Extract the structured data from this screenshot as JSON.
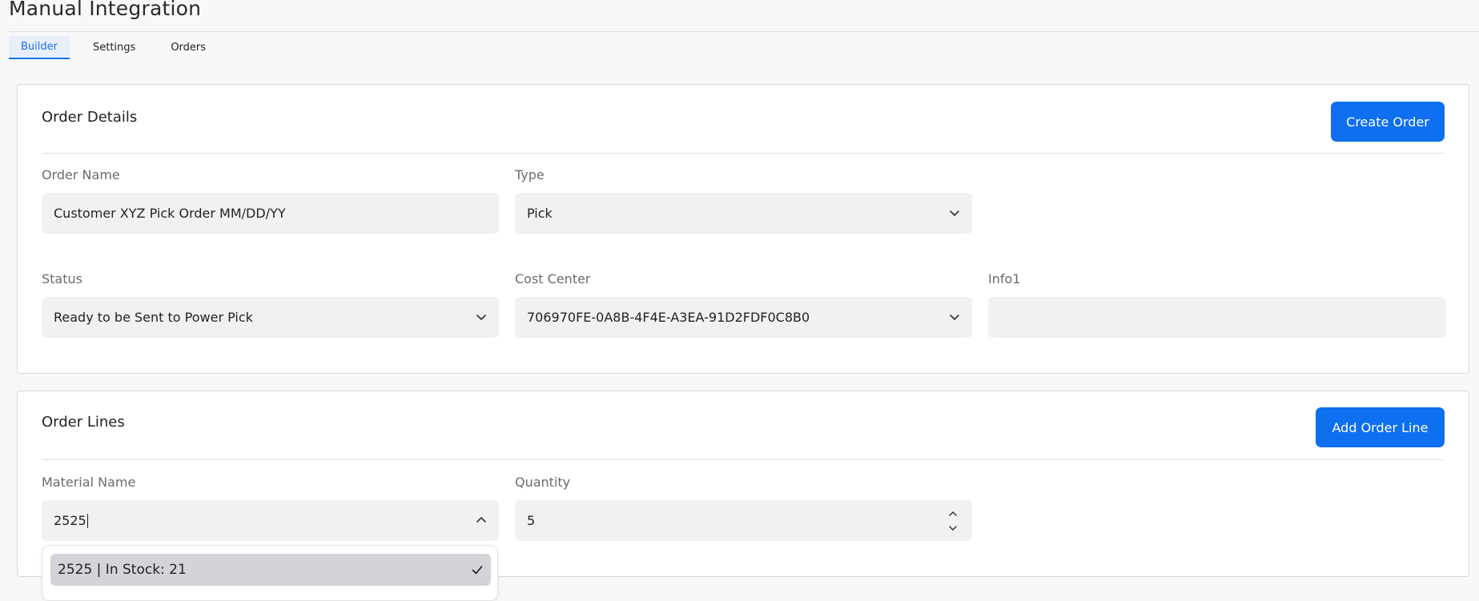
{
  "page": {
    "title": "Manual Integration"
  },
  "tabs": [
    {
      "label": "Builder",
      "active": true
    },
    {
      "label": "Settings",
      "active": false
    },
    {
      "label": "Orders",
      "active": false
    }
  ],
  "order_details": {
    "title": "Order Details",
    "create_button": "Create Order",
    "order_name": {
      "label": "Order Name",
      "value": "Customer XYZ Pick Order MM/DD/YY"
    },
    "type": {
      "label": "Type",
      "value": "Pick"
    },
    "status": {
      "label": "Status",
      "value": "Ready to be Sent to Power Pick"
    },
    "cost_center": {
      "label": "Cost Center",
      "value": "706970FE-0A8B-4F4E-A3EA-91D2FDF0C8B0"
    },
    "info1": {
      "label": "Info1",
      "value": ""
    }
  },
  "order_lines": {
    "title": "Order Lines",
    "add_button": "Add Order Line",
    "material_name": {
      "label": "Material Name",
      "value": "2525"
    },
    "quantity": {
      "label": "Quantity",
      "value": "5"
    },
    "dropdown_options": [
      {
        "label": "2525 | In Stock: 21",
        "selected": true
      }
    ]
  },
  "icons": {
    "chevron_down": "chevron-down-icon",
    "chevron_up": "chevron-up-icon",
    "checkmark": "check-icon",
    "stepper": "number-stepper-icon"
  },
  "colors": {
    "accent": "#0e6ff0",
    "tab_active_text": "#1f6ee6",
    "field_bg": "#f1f1f1",
    "selected_option_bg": "#d4d4d8"
  }
}
